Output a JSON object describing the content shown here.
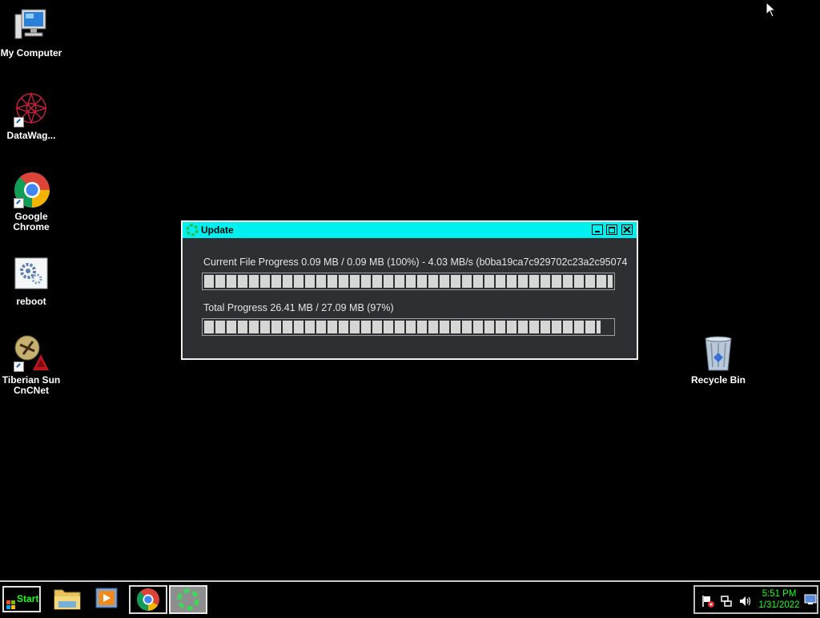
{
  "desktop": {
    "icons": [
      {
        "label": "My Computer"
      },
      {
        "label": "DataWag..."
      },
      {
        "label": "Google Chrome"
      },
      {
        "label": "reboot"
      },
      {
        "label": "Tiberian Sun CnCNet"
      },
      {
        "label": "Recycle Bin"
      }
    ]
  },
  "update_window": {
    "title": "Update",
    "current_file_label": "Current File Progress 0.09 MB / 0.09 MB (100%) - 4.03 MB/s (b0ba19ca7c929702c23a2c95074",
    "current_file_progress": 1.0,
    "total_label": "Total Progress 26.41 MB / 27.09 MB (97%)",
    "total_progress": 0.97
  },
  "taskbar": {
    "start_label": "Start",
    "time": "5:51 PM",
    "date": "1/31/2022"
  },
  "colors": {
    "titlebar": "#00f0f0",
    "window_bg": "#2d2f33",
    "start_text": "#1aff1a",
    "clock_text": "#1aff1a"
  }
}
